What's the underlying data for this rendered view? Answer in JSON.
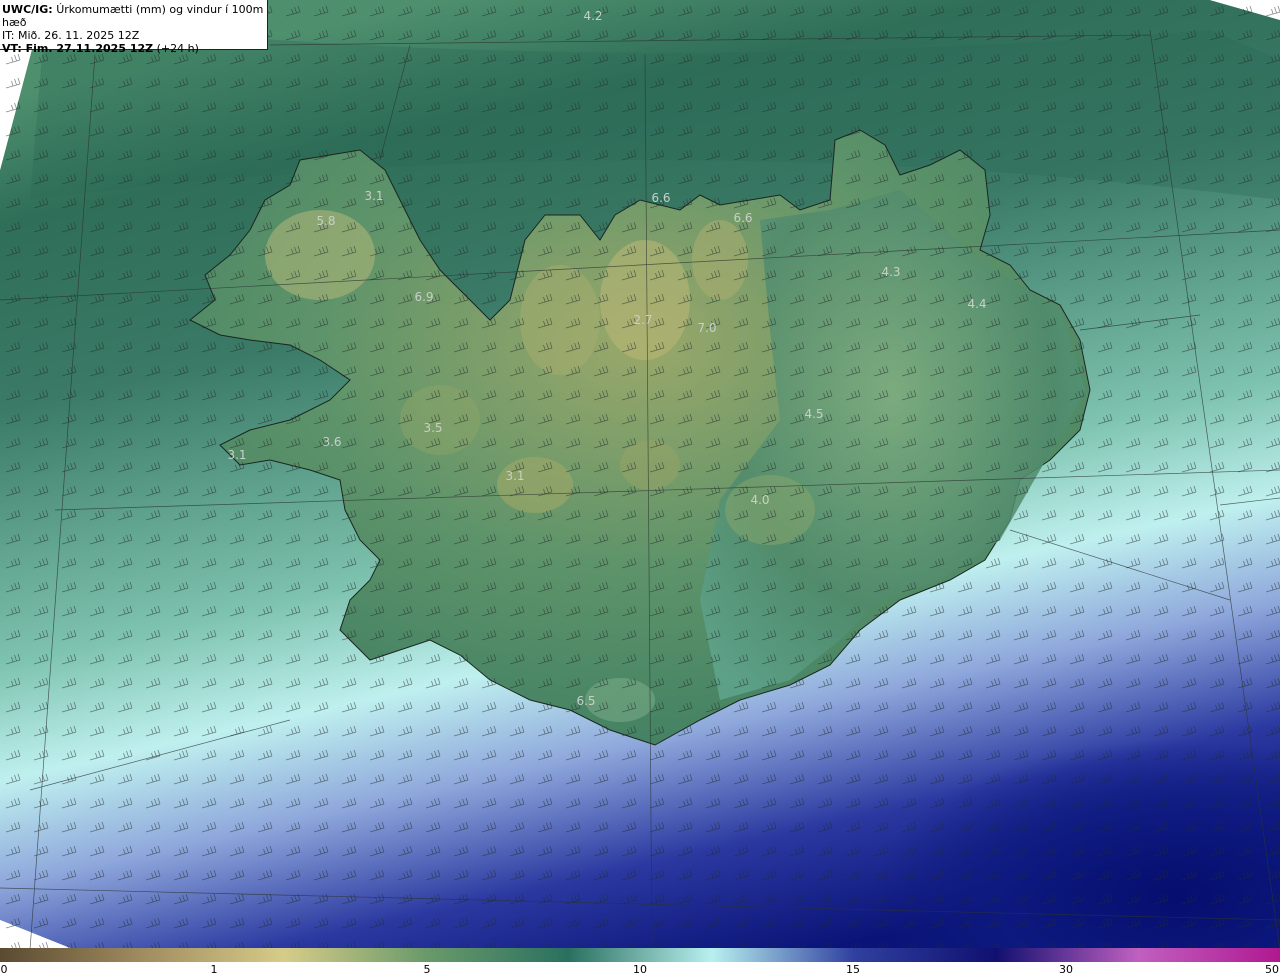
{
  "header": {
    "model": "UWC/IG:",
    "title": "Úrkomumætti (mm) og vindur í 100m hæð",
    "it_line": "IT: Mið. 26. 11. 2025 12Z",
    "vt_strong": "VT: Fim. 27.11.2025 12Z",
    "vt_suffix": " (+24 h)"
  },
  "map_values": [
    "4.2",
    "3.1",
    "5.8",
    "6.9",
    "6.6",
    "6.6",
    "2.7",
    "7.0",
    "4.3",
    "4.4",
    "4.5",
    "3.5",
    "3.6",
    "3.1",
    "3.1",
    "4.0",
    "6.5"
  ],
  "colorbar": {
    "ticks": [
      "0",
      "1",
      "5",
      "10",
      "15",
      "30",
      "50"
    ],
    "colors": [
      "#5a4a30",
      "#a08c60",
      "#d6cc88",
      "#6a9a6a",
      "#2a7060",
      "#b8f0f0",
      "#3040a0",
      "#101070",
      "#c060c0",
      "#b01890"
    ]
  },
  "colors": {
    "land_dark": "#3f7a55",
    "land_light": "#a7b36e",
    "sea_green": "#5d9a78",
    "sea_light": "#b8ecec",
    "sea_blue": "#3a48a8",
    "sea_deep": "#0a1478"
  }
}
